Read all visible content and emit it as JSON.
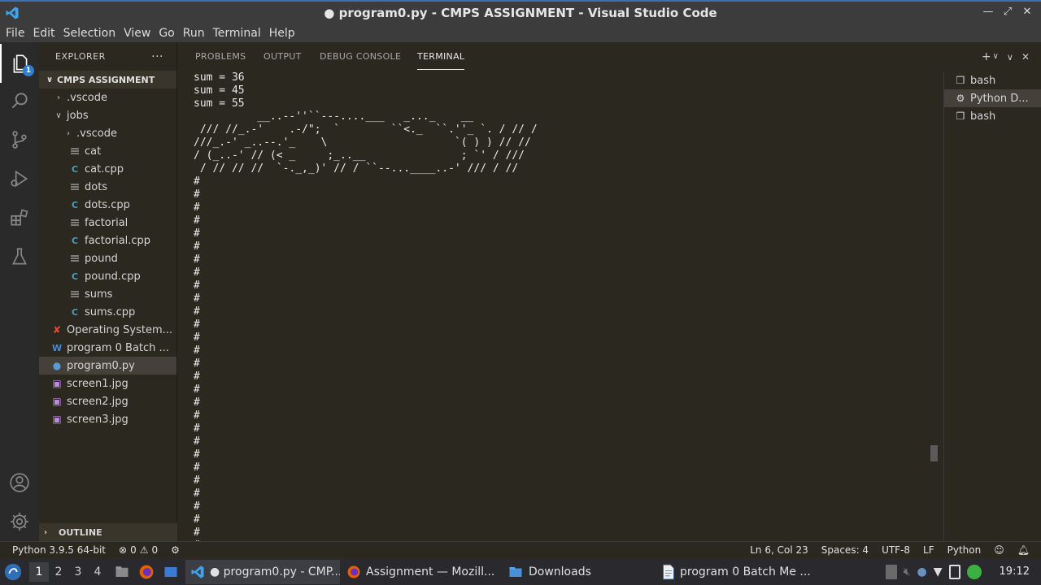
{
  "window": {
    "title": "● program0.py - CMPS ASSIGNMENT - Visual Studio Code"
  },
  "menu": [
    "File",
    "Edit",
    "Selection",
    "View",
    "Go",
    "Run",
    "Terminal",
    "Help"
  ],
  "activity_bar": {
    "explorer_badge": "1"
  },
  "explorer": {
    "header": "EXPLORER",
    "more": "···",
    "root": "CMPS ASSIGNMENT",
    "items": [
      {
        "label": ".vscode",
        "depth": 1,
        "kind": "folder-closed"
      },
      {
        "label": "jobs",
        "depth": 1,
        "kind": "folder-open"
      },
      {
        "label": ".vscode",
        "depth": 2,
        "kind": "folder-closed"
      },
      {
        "label": "cat",
        "depth": 2,
        "kind": "file"
      },
      {
        "label": "cat.cpp",
        "depth": 2,
        "kind": "cpp"
      },
      {
        "label": "dots",
        "depth": 2,
        "kind": "file"
      },
      {
        "label": "dots.cpp",
        "depth": 2,
        "kind": "cpp"
      },
      {
        "label": "factorial",
        "depth": 2,
        "kind": "file"
      },
      {
        "label": "factorial.cpp",
        "depth": 2,
        "kind": "cpp"
      },
      {
        "label": "pound",
        "depth": 2,
        "kind": "file"
      },
      {
        "label": "pound.cpp",
        "depth": 2,
        "kind": "cpp"
      },
      {
        "label": "sums",
        "depth": 2,
        "kind": "file"
      },
      {
        "label": "sums.cpp",
        "depth": 2,
        "kind": "cpp"
      },
      {
        "label": "Operating System...",
        "depth": 1,
        "kind": "pdf"
      },
      {
        "label": "program 0 Batch ...",
        "depth": 1,
        "kind": "doc"
      },
      {
        "label": "program0.py",
        "depth": 1,
        "kind": "py",
        "selected": true
      },
      {
        "label": "screen1.jpg",
        "depth": 1,
        "kind": "img"
      },
      {
        "label": "screen2.jpg",
        "depth": 1,
        "kind": "img"
      },
      {
        "label": "screen3.jpg",
        "depth": 1,
        "kind": "img"
      }
    ],
    "outline": "OUTLINE"
  },
  "panel": {
    "tabs": [
      {
        "label": "PROBLEMS",
        "active": false
      },
      {
        "label": "OUTPUT",
        "active": false
      },
      {
        "label": "DEBUG CONSOLE",
        "active": false
      },
      {
        "label": "TERMINAL",
        "active": true
      }
    ]
  },
  "terminal": {
    "lines": [
      "sum = 36",
      "sum = 45",
      "sum = 55",
      "          __..--''``---....___   _..._    __",
      " /// //_.-'    .-/\";  `        ``<._  ``.''_ `. / // /",
      "///_.-' _..--.'_    \\                    `( ) ) // //",
      "/ (_..-' // (< _     ;_..__               ; `' / ///",
      " / // // //  `-._,_)' // / ``--...____..-' /// / //",
      "#",
      "#",
      "#",
      "#",
      "#",
      "#",
      "#",
      "#",
      "#",
      "#",
      "#",
      "#",
      "#",
      "#",
      "#",
      "#",
      "#",
      "#",
      "#",
      "#",
      "#",
      "#",
      "#",
      "#",
      "#",
      "#",
      "#",
      "#",
      "#",
      "#"
    ]
  },
  "terminal_list": [
    {
      "label": "bash",
      "icon": "terminal-icon",
      "active": false
    },
    {
      "label": "Python D...",
      "icon": "debug-icon",
      "active": true
    },
    {
      "label": "bash",
      "icon": "terminal-icon",
      "active": false
    }
  ],
  "status_bar": {
    "interpreter": "Python 3.9.5 64-bit",
    "errors": "0",
    "warnings": "0",
    "cursor": "Ln 6, Col 23",
    "spaces": "Spaces: 4",
    "encoding": "UTF-8",
    "eol": "LF",
    "language": "Python"
  },
  "taskbar": {
    "workspaces": [
      "1",
      "2",
      "3",
      "4"
    ],
    "tasks": [
      {
        "label": "● program0.py - CMP...",
        "icon": "vscode-icon",
        "active": true
      },
      {
        "label": "Assignment — Mozill...",
        "icon": "firefox-icon",
        "active": false
      },
      {
        "label": "Downloads",
        "icon": "folder-icon",
        "active": false
      },
      {
        "label": "program 0 Batch Me ...",
        "icon": "document-icon",
        "active": false
      }
    ],
    "clock": "19:12"
  },
  "colors": {
    "accent": "#2f7fd0",
    "background": "#2b2820",
    "titlebar": "#3c3c3c"
  }
}
